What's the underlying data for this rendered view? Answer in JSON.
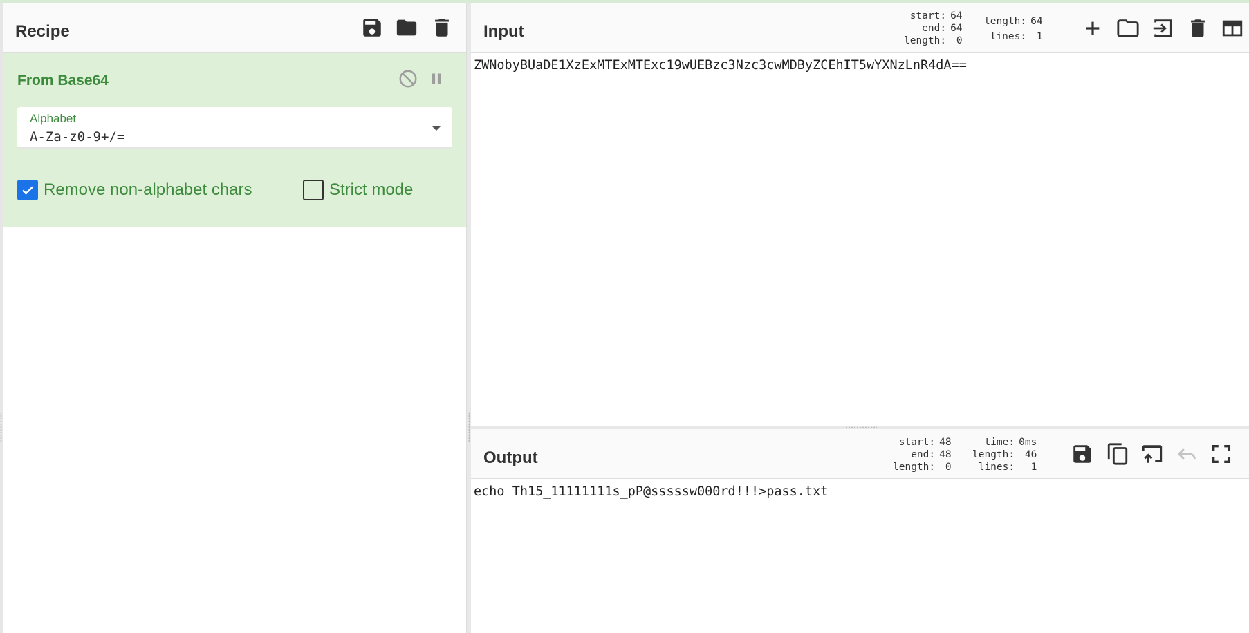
{
  "recipe": {
    "title": "Recipe",
    "icons": [
      "save-icon",
      "folder-icon",
      "trash-icon"
    ],
    "operation": {
      "name": "From Base64",
      "icons": [
        "disable-icon",
        "pause-icon"
      ],
      "alphabet_label": "Alphabet",
      "alphabet_value": "A-Za-z0-9+/=",
      "checkboxes": [
        {
          "label": "Remove non-alphabet chars",
          "checked": true
        },
        {
          "label": "Strict mode",
          "checked": false
        }
      ]
    }
  },
  "input": {
    "title": "Input",
    "stats": {
      "start_label": "start:",
      "start": "64",
      "end_label": "end:",
      "end": "64",
      "sel_length_label": "length:",
      "sel_length": "0",
      "length_label": "length:",
      "length": "64",
      "lines_label": "lines:",
      "lines": "1"
    },
    "icons": [
      "plus-icon",
      "folder-icon",
      "sign-in-icon",
      "trash-icon",
      "layout-icon"
    ],
    "text": "ZWNobyBUaDE1XzExMTExMTExc19wUEBzc3Nzc3cwMDByZCEhIT5wYXNzLnR4dA=="
  },
  "output": {
    "title": "Output",
    "stats": {
      "start_label": "start:",
      "start": "48",
      "end_label": "end:",
      "end": "48",
      "sel_length_label": "length:",
      "sel_length": "0",
      "time_label": "time:",
      "time": "0ms",
      "length_label": "length:",
      "length": "46",
      "lines_label": "lines:",
      "lines": "1"
    },
    "icons": [
      "save-icon",
      "copy-icon",
      "replace-input-icon",
      "undo-icon",
      "fullscreen-icon"
    ],
    "text": "echo Th15_11111111s_pP@sssssw000rd!!!>pass.txt"
  },
  "colors": {
    "operation_bg": "#dff0d8",
    "operation_text": "#3c8a3c",
    "checkbox_checked": "#1b73e8"
  }
}
